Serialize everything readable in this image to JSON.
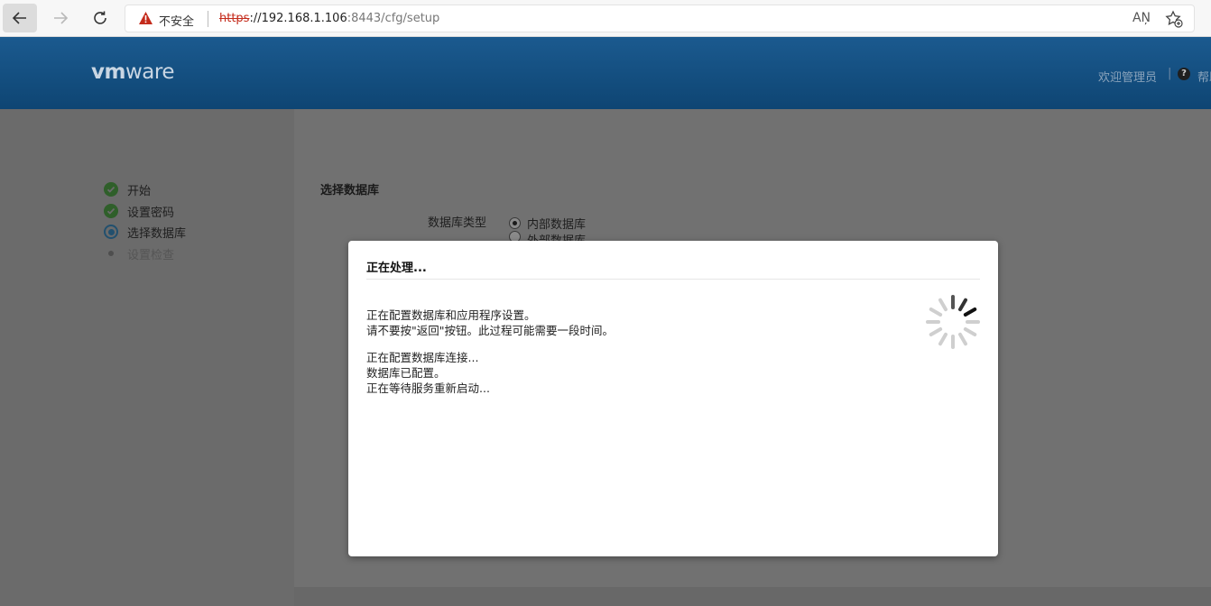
{
  "browser": {
    "security_label": "不安全",
    "url_scheme": "https",
    "url_host": "://192.168.1.106",
    "url_rest": ":8443/cfg/setup",
    "read_aloud": "AŅ"
  },
  "header": {
    "logo_vm": "vm",
    "logo_ware": "ware",
    "welcome": "欢迎管理员",
    "separator": "|",
    "help_icon": "?",
    "help_label": "帮助"
  },
  "steps": [
    {
      "label": "开始",
      "status": "done"
    },
    {
      "label": "设置密码",
      "status": "done"
    },
    {
      "label": "选择数据库",
      "status": "current"
    },
    {
      "label": "设置检查",
      "status": "pending"
    }
  ],
  "content": {
    "section_title": "选择数据库",
    "db_type_label": "数据库类型",
    "options": [
      "内部数据库",
      "外部数据库"
    ]
  },
  "modal": {
    "title": "正在处理...",
    "lines": [
      "正在配置数据库和应用程序设置。",
      "请不要按\"返回\"按钮。此过程可能需要一段时间。",
      "正在配置数据库连接...",
      "数据库已配置。",
      "正在等待服务重新启动..."
    ]
  },
  "colors": {
    "header_top": "#1b5a8f",
    "header_bottom": "#0e4573",
    "insecure_red": "#c42b1c",
    "overlay_gray": "#6b6b6b"
  }
}
